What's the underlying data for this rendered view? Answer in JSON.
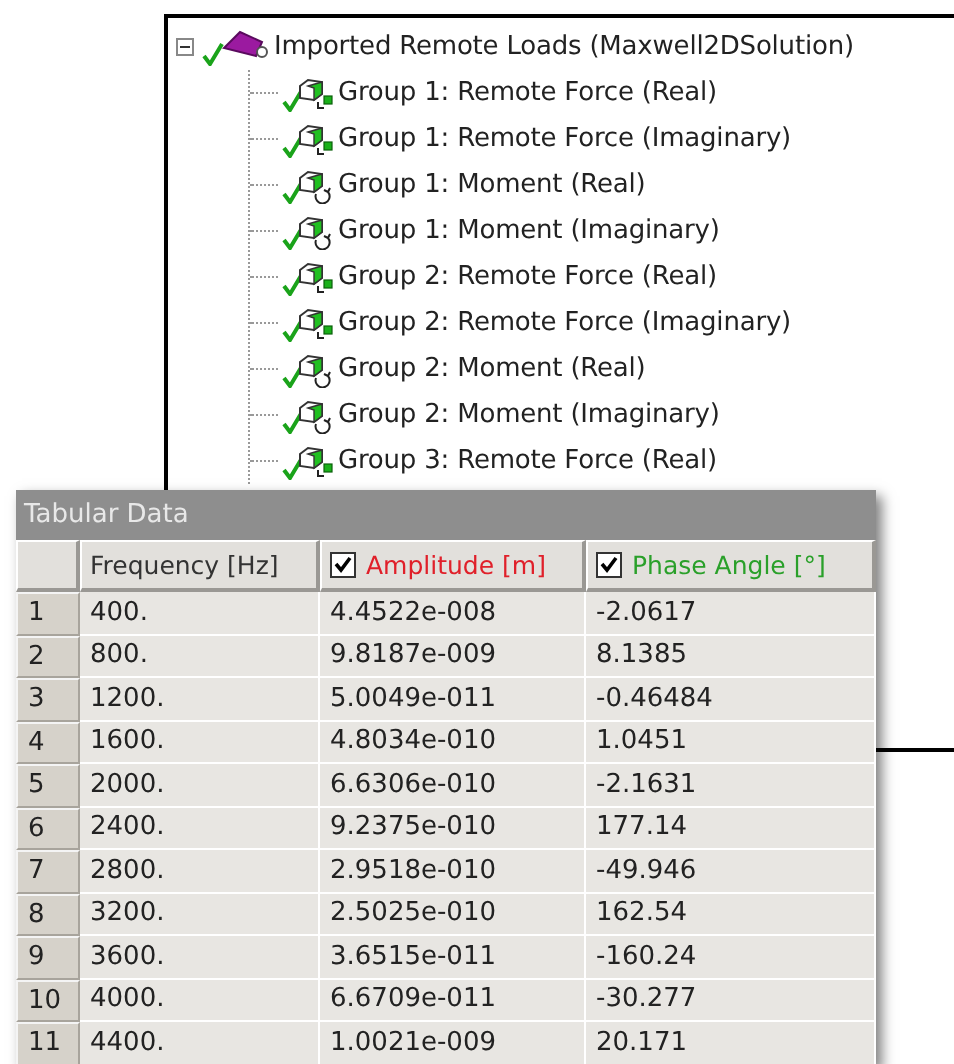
{
  "tree": {
    "root": {
      "label": "Imported Remote Loads (Maxwell2DSolution)",
      "expanded": true,
      "children": [
        {
          "label": "Group 1: Remote Force (Real)",
          "kind": "force"
        },
        {
          "label": "Group 1: Remote Force (Imaginary)",
          "kind": "force"
        },
        {
          "label": "Group 1: Moment (Real)",
          "kind": "moment"
        },
        {
          "label": "Group 1: Moment (Imaginary)",
          "kind": "moment"
        },
        {
          "label": "Group 2: Remote Force (Real)",
          "kind": "force"
        },
        {
          "label": "Group 2: Remote Force (Imaginary)",
          "kind": "force"
        },
        {
          "label": "Group 2: Moment (Real)",
          "kind": "moment"
        },
        {
          "label": "Group 2: Moment (Imaginary)",
          "kind": "moment"
        },
        {
          "label": "Group 3: Remote Force (Real)",
          "kind": "force"
        }
      ]
    }
  },
  "table": {
    "title": "Tabular Data",
    "columns": [
      {
        "label": "Frequency [Hz]",
        "kind": "plain",
        "color": "#333333"
      },
      {
        "label": "Amplitude [m]",
        "kind": "checkbox",
        "checked": true,
        "color": "#e0202a"
      },
      {
        "label": "Phase Angle [°]",
        "kind": "checkbox",
        "checked": true,
        "color": "#2aa02a"
      }
    ],
    "rows": [
      {
        "index": "1",
        "cells": [
          "400.",
          "4.4522e-008",
          "-2.0617"
        ]
      },
      {
        "index": "2",
        "cells": [
          "800.",
          "9.8187e-009",
          "8.1385"
        ]
      },
      {
        "index": "3",
        "cells": [
          "1200.",
          "5.0049e-011",
          "-0.46484"
        ]
      },
      {
        "index": "4",
        "cells": [
          "1600.",
          "4.8034e-010",
          "1.0451"
        ]
      },
      {
        "index": "5",
        "cells": [
          "2000.",
          "6.6306e-010",
          "-2.1631"
        ]
      },
      {
        "index": "6",
        "cells": [
          "2400.",
          "9.2375e-010",
          "177.14"
        ]
      },
      {
        "index": "7",
        "cells": [
          "2800.",
          "2.9518e-010",
          "-49.946"
        ]
      },
      {
        "index": "8",
        "cells": [
          "3200.",
          "2.5025e-010",
          "162.54"
        ]
      },
      {
        "index": "9",
        "cells": [
          "3600.",
          "3.6515e-011",
          "-160.24"
        ]
      },
      {
        "index": "10",
        "cells": [
          "4000.",
          "6.6709e-011",
          "-30.277"
        ]
      },
      {
        "index": "11",
        "cells": [
          "4400.",
          "1.0021e-009",
          "20.171"
        ]
      }
    ]
  }
}
